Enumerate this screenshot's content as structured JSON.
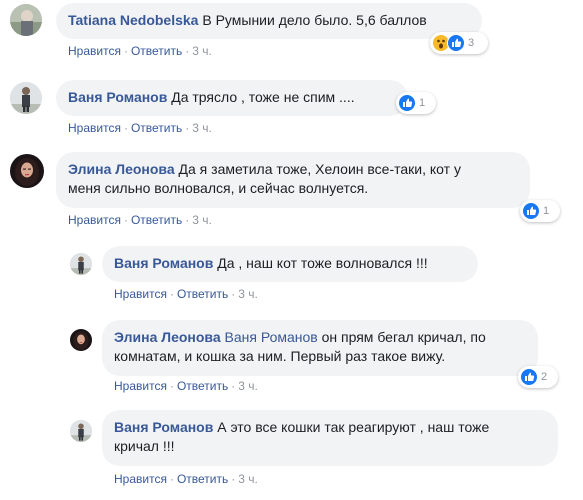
{
  "colors": {
    "link": "#385898",
    "bubble": "#f2f3f5",
    "meta": "#90949c",
    "like_blue": "#1877f2",
    "wow_yellow": "#f7b928"
  },
  "comments": [
    {
      "author": "Tatiana Nedobelska",
      "text": "В Румынии дело было. 5,6 баллов",
      "actions": {
        "like": "Нравится",
        "reply": "Ответить",
        "time": "3 ч."
      },
      "reactions": {
        "icons": [
          "wow-icon",
          "like-icon"
        ],
        "count": "3"
      }
    },
    {
      "author": "Ваня Романов",
      "text": "Да трясло , тоже не спим ....",
      "actions": {
        "like": "Нравится",
        "reply": "Ответить",
        "time": "3 ч."
      },
      "reactions": {
        "icons": [
          "like-icon"
        ],
        "count": "1"
      }
    },
    {
      "author": "Элина Леонова",
      "text_line1": "Да я заметила тоже, Хелоин все-таки, кот у",
      "text_line2": "меня сильно волновался, и сейчас волнуется.",
      "actions": {
        "like": "Нравится",
        "reply": "Ответить",
        "time": "3 ч."
      },
      "reactions": {
        "icons": [
          "like-icon"
        ],
        "count": "1"
      }
    }
  ],
  "replies": [
    {
      "author": "Ваня Романов",
      "text": "Да , наш кот тоже волновался !!!",
      "actions": {
        "like": "Нравится",
        "reply": "Ответить",
        "time": "3 ч."
      }
    },
    {
      "author": "Элина Леонова",
      "mention": "Ваня Романов",
      "text_line1": "он прям бегал кричал, по",
      "text_line2": "комнатам, и кошка за ним. Первый раз такое вижу.",
      "actions": {
        "like": "Нравится",
        "reply": "Ответить",
        "time": "3 ч."
      },
      "reactions": {
        "icons": [
          "like-icon"
        ],
        "count": "2"
      }
    },
    {
      "author": "Ваня Романов",
      "text_line1": "А это все кошки так реагируют , наш тоже",
      "text_line2": "кричал !!!",
      "actions": {
        "like": "Нравится",
        "reply": "Ответить",
        "time": "3 ч."
      }
    }
  ]
}
